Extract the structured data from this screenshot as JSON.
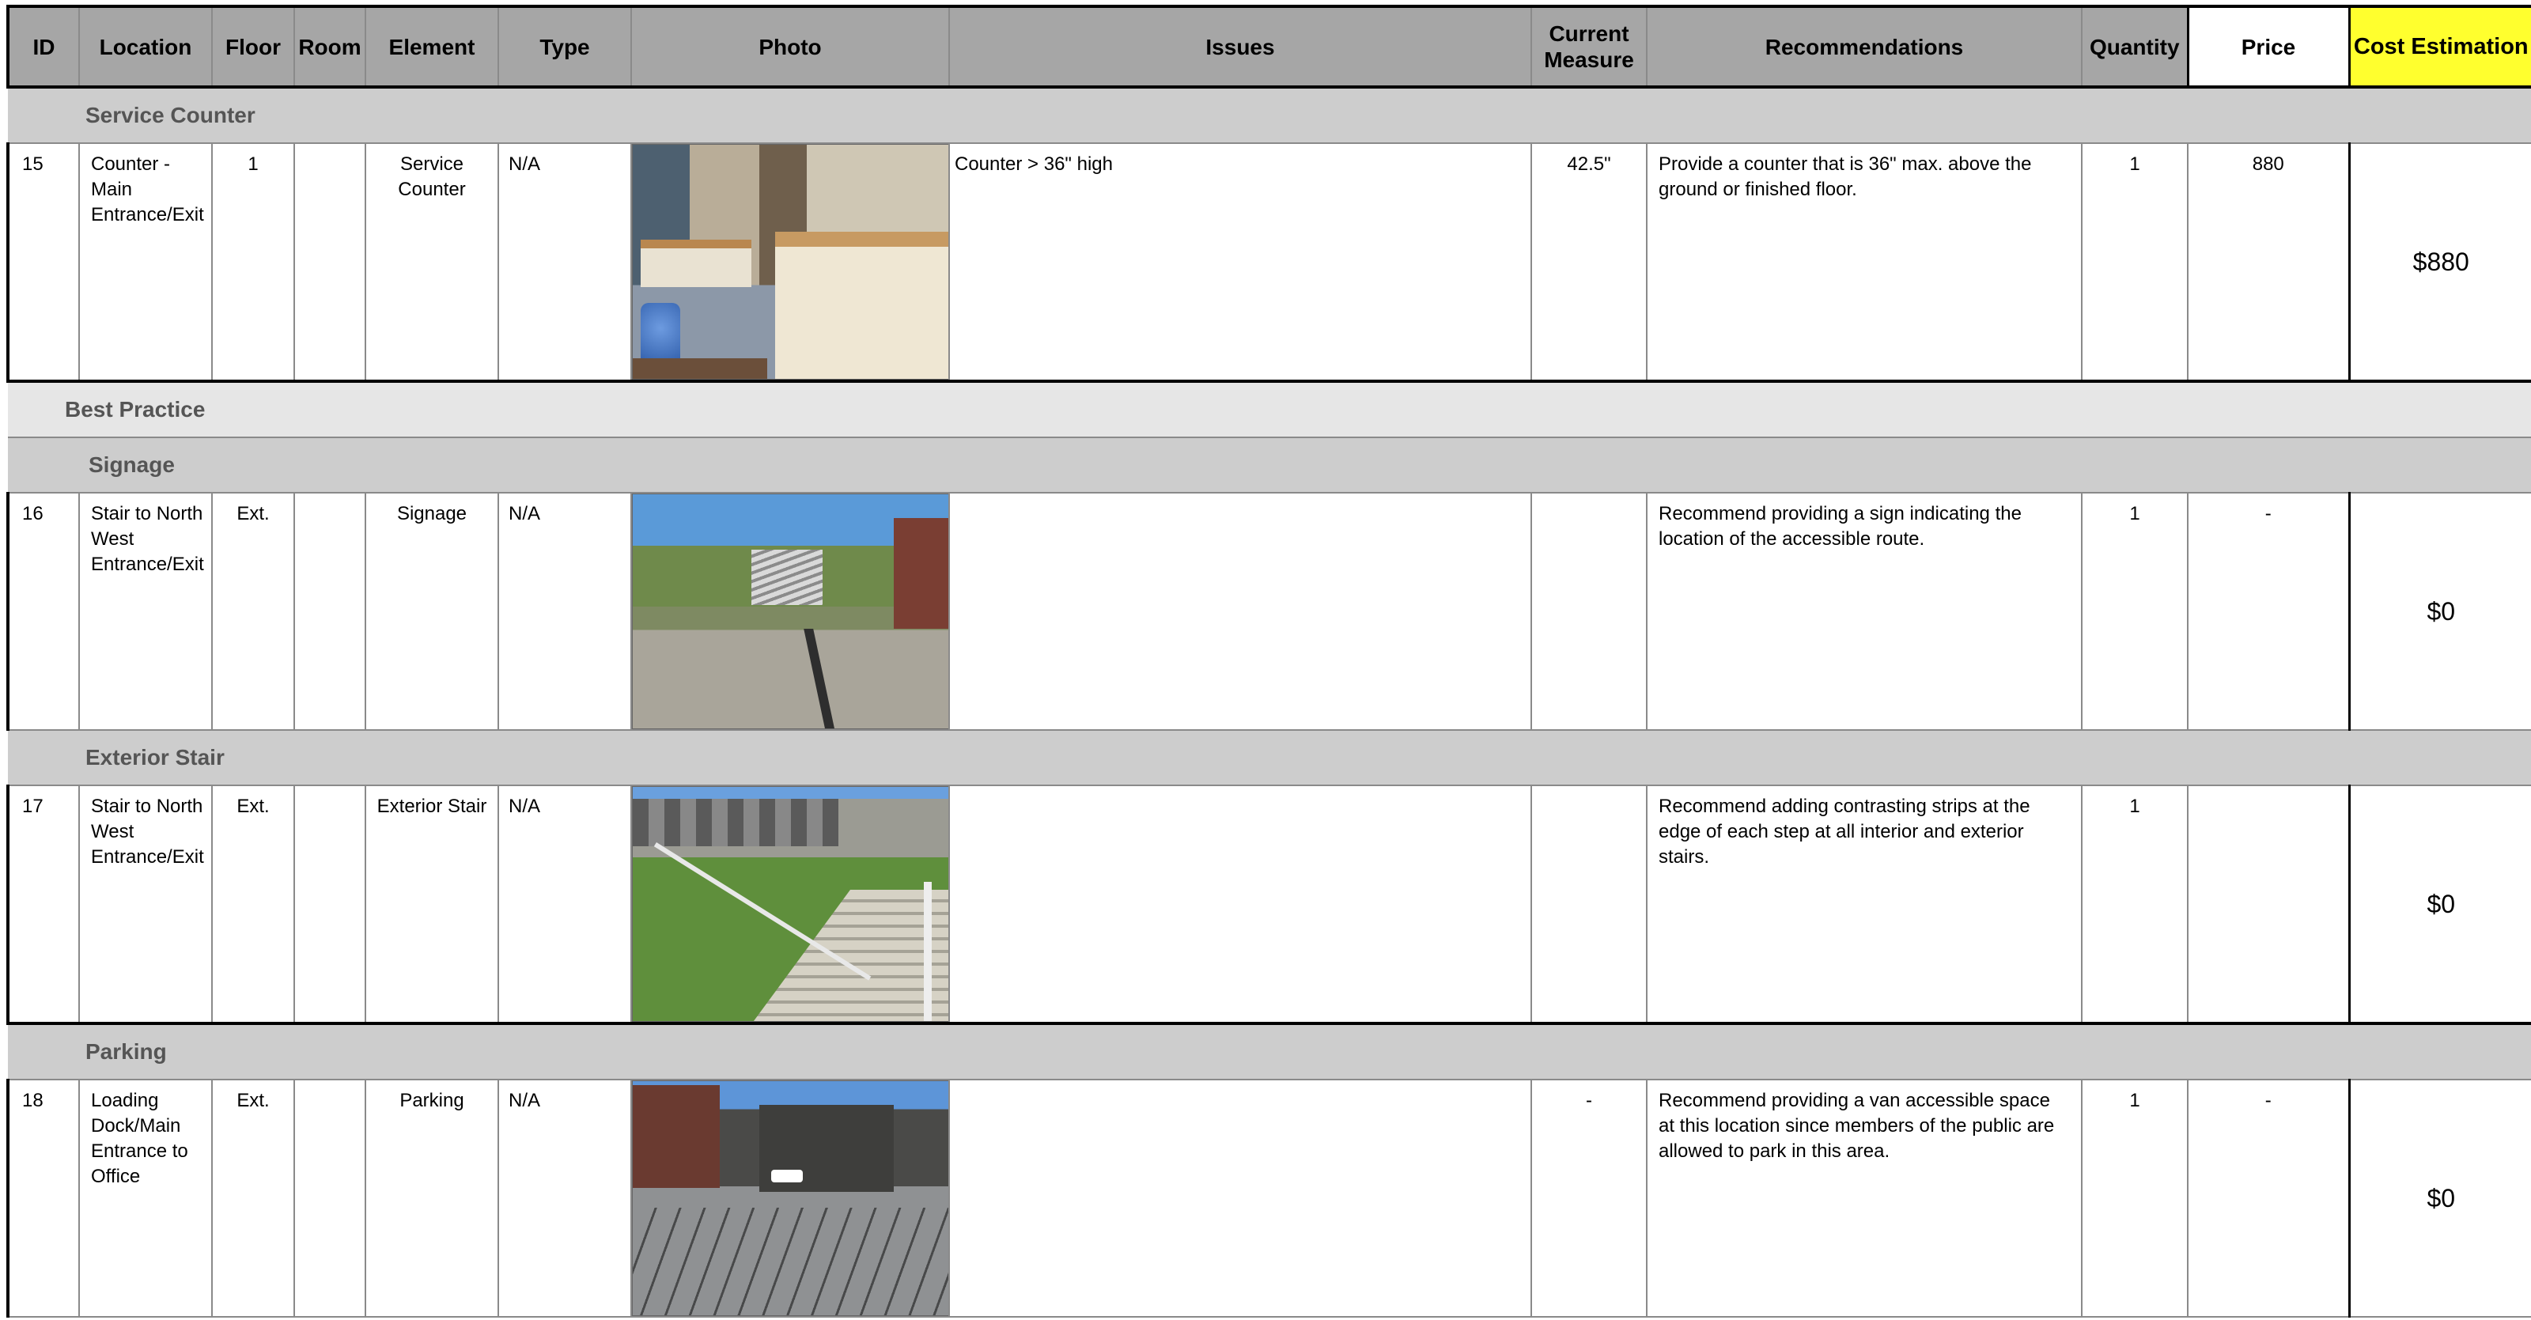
{
  "header": {
    "id": "ID",
    "location": "Location",
    "floor": "Floor",
    "room": "Room",
    "element": "Element",
    "type": "Type",
    "photo": "Photo",
    "issues": "Issues",
    "current_measure": "Current Measure",
    "recommendations": "Recommendations",
    "quantity": "Quantity",
    "price": "Price",
    "cost_estimation": "Cost Estimation"
  },
  "sections": {
    "service_counter": "Service Counter",
    "best_practice": "Best Practice",
    "signage": "Signage",
    "exterior_stair": "Exterior Stair",
    "parking": "Parking"
  },
  "rows": [
    {
      "id": "15",
      "location": "Counter - Main Entrance/Exit",
      "floor": "1",
      "room": "",
      "element": "Service Counter",
      "type": "N/A",
      "photo_icon": "office-counter-photo",
      "issues": "Counter > 36\" high",
      "current_measure": "42.5\"",
      "recommendations": "Provide a counter that is 36\" max. above the ground or finished floor.",
      "quantity": "1",
      "price": "880",
      "cost": "$880"
    },
    {
      "id": "16",
      "location": "Stair to North West Entrance/Exit",
      "floor": "Ext.",
      "room": "",
      "element": "Signage",
      "type": "N/A",
      "photo_icon": "exterior-route-photo",
      "issues": "",
      "current_measure": "",
      "recommendations": "Recommend providing a sign indicating the location of the accessible route.",
      "quantity": "1",
      "price": "-",
      "cost": "$0"
    },
    {
      "id": "17",
      "location": "Stair to North West Entrance/Exit",
      "floor": "Ext.",
      "room": "",
      "element": "Exterior Stair",
      "type": "N/A",
      "photo_icon": "exterior-stair-photo",
      "issues": "",
      "current_measure": "",
      "recommendations": "Recommend adding contrasting strips at the edge of each step at all interior and exterior stairs.",
      "quantity": "1",
      "price": "",
      "cost": "$0"
    },
    {
      "id": "18",
      "location": "Loading Dock/Main Entrance to Office",
      "floor": "Ext.",
      "room": "",
      "element": "Parking",
      "type": "N/A",
      "photo_icon": "parking-lot-photo",
      "issues": "",
      "current_measure": "-",
      "recommendations": "Recommend providing a van accessible space at this location since members of the public are allowed to park in this area.",
      "quantity": "1",
      "price": "-",
      "cost": "$0"
    }
  ]
}
